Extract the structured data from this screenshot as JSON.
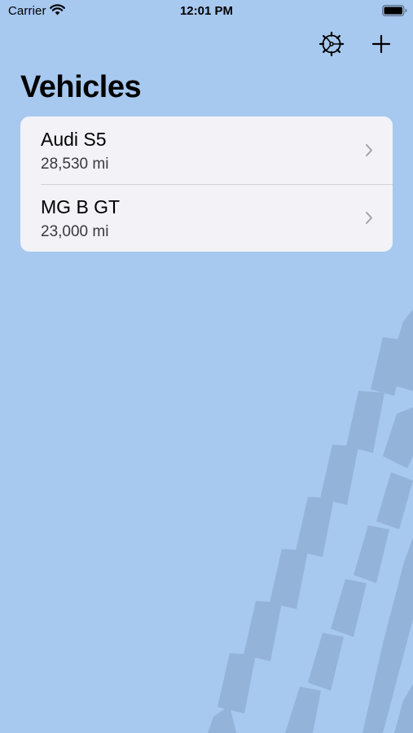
{
  "status_bar": {
    "carrier": "Carrier",
    "time": "12:01 PM",
    "icons": [
      "wifi-icon",
      "battery-icon"
    ]
  },
  "nav": {
    "settings_icon": "gear-icon",
    "add_icon": "plus-icon"
  },
  "page": {
    "title": "Vehicles"
  },
  "vehicles": [
    {
      "name": "Audi S5",
      "mileage": "28,530 mi"
    },
    {
      "name": "MG B GT",
      "mileage": "23,000 mi"
    }
  ],
  "colors": {
    "background": "#a7c8ef",
    "card": "#f2f2f7",
    "tread": "#94b3d8",
    "separator": "#d1d1d6",
    "chevron": "#a4a4a8"
  }
}
